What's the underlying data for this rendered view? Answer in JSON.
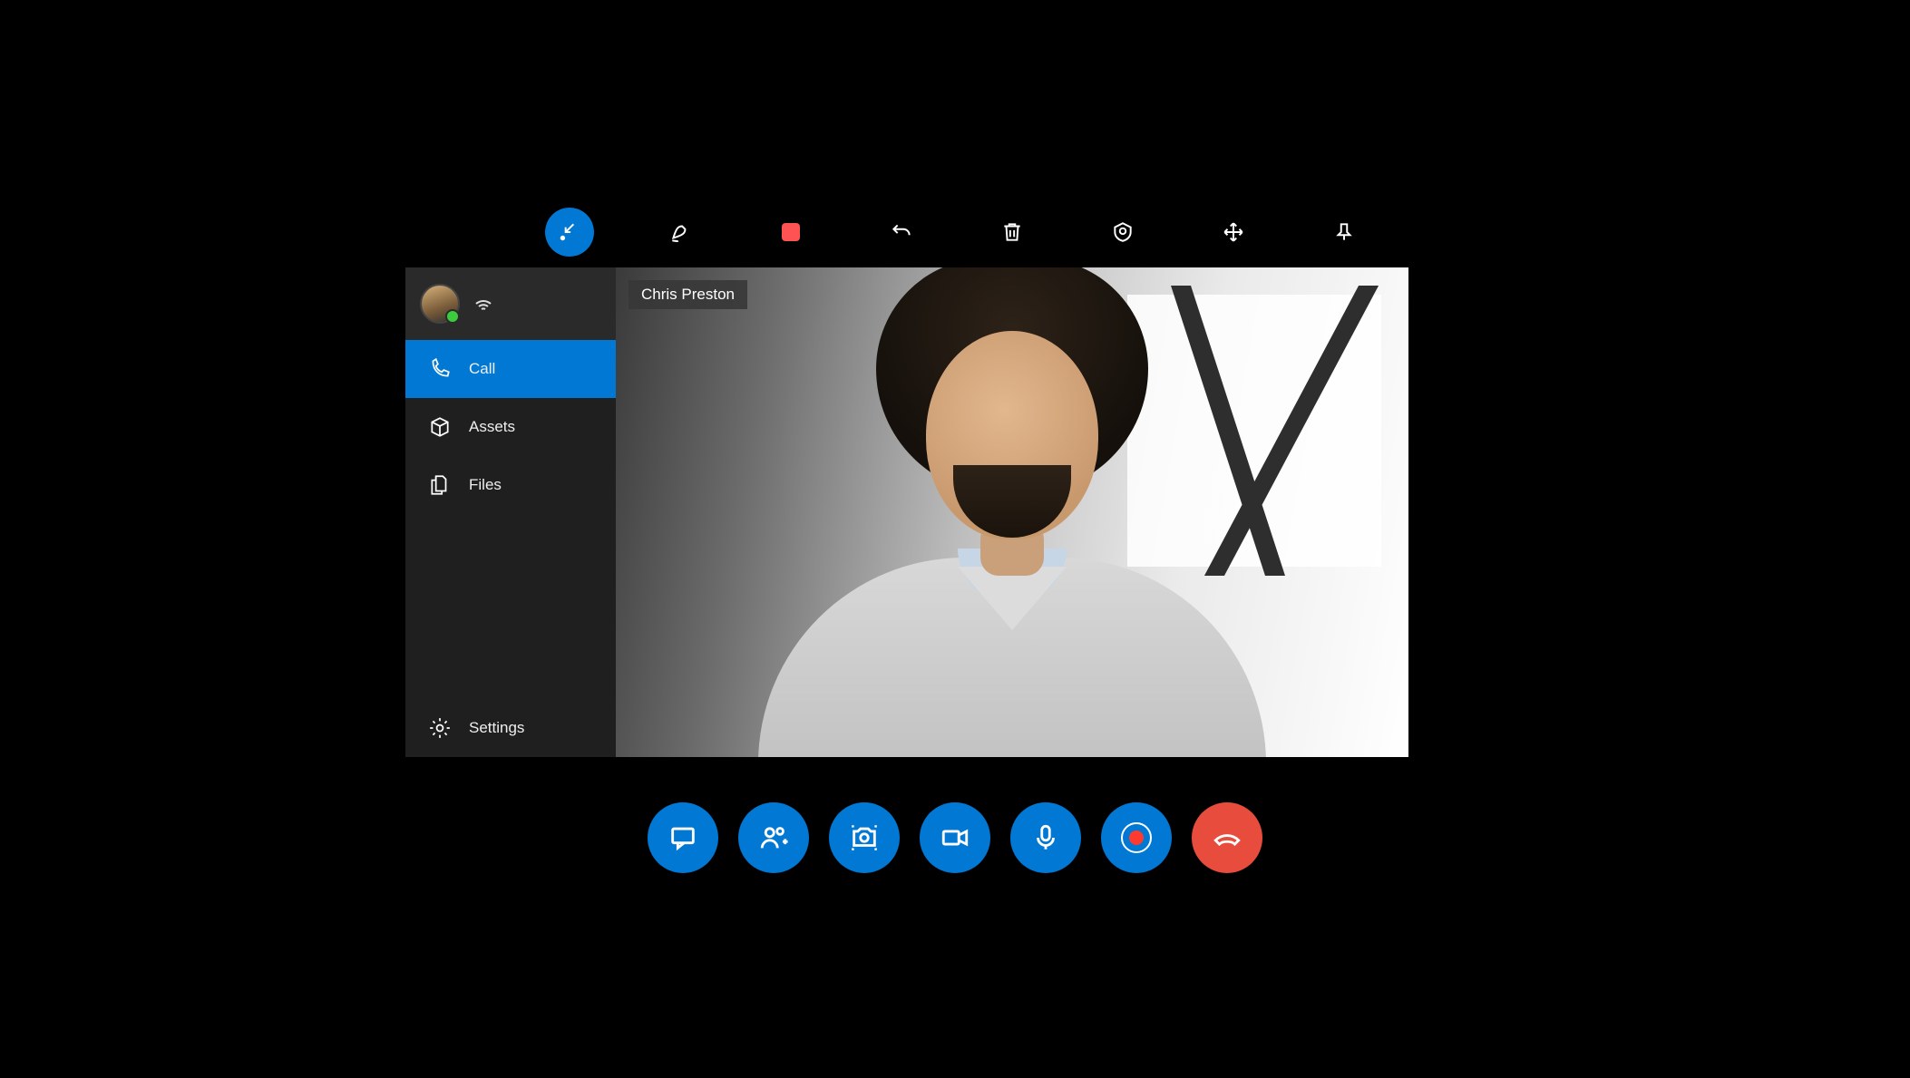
{
  "toolbar": {
    "collapse_icon": "collapse-icon",
    "ink_icon": "ink-icon",
    "stop_icon": "stop-icon",
    "undo_icon": "undo-icon",
    "delete_icon": "trash-icon",
    "location_icon": "location-icon",
    "move_icon": "move-icon",
    "pin_icon": "pin-icon"
  },
  "sidebar": {
    "status_icon": "wifi-icon",
    "items": [
      {
        "icon": "phone-icon",
        "label": "Call",
        "active": true
      },
      {
        "icon": "package-icon",
        "label": "Assets",
        "active": false
      },
      {
        "icon": "files-icon",
        "label": "Files",
        "active": false
      }
    ],
    "footer": {
      "icon": "gear-icon",
      "label": "Settings"
    }
  },
  "video": {
    "participant_name": "Chris Preston"
  },
  "callbar": {
    "chat": "chat-icon",
    "add_people": "add-people-icon",
    "snapshot": "snapshot-icon",
    "video": "video-icon",
    "mic": "mic-icon",
    "record": "record-icon",
    "hangup": "hangup-icon"
  },
  "colors": {
    "accent": "#0078d4",
    "danger": "#e74c3c",
    "record_red": "#ff3b30"
  }
}
